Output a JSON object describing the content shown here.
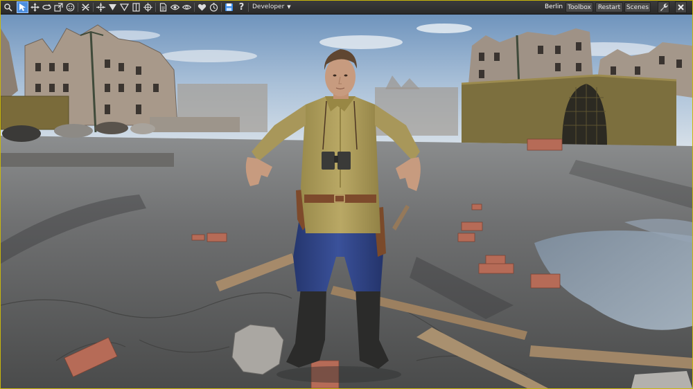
{
  "toolbar": {
    "tools": [
      {
        "name": "zoom-icon",
        "active": false
      },
      {
        "name": "select-cursor-icon",
        "active": true
      },
      {
        "name": "move-icon",
        "active": false
      },
      {
        "name": "rotate-icon",
        "active": false
      },
      {
        "name": "scale-icon",
        "active": false
      },
      {
        "name": "smiley-icon",
        "active": false
      },
      {
        "name": "cross-icon",
        "active": false
      },
      {
        "name": "snap-icon",
        "active": false
      },
      {
        "name": "filter-icon",
        "active": false
      },
      {
        "name": "funnel-icon",
        "active": false
      },
      {
        "name": "panel-icon",
        "active": false
      },
      {
        "name": "crosshair-icon",
        "active": false
      },
      {
        "name": "document-icon",
        "active": false
      },
      {
        "name": "eye-icon",
        "active": false
      },
      {
        "name": "eye-outline-icon",
        "active": false
      },
      {
        "name": "heart-icon",
        "active": false
      },
      {
        "name": "clock-icon",
        "active": false
      },
      {
        "name": "save-icon",
        "active": false
      },
      {
        "name": "help-icon",
        "active": false
      }
    ],
    "mode_select": {
      "value": "Developer"
    },
    "location_label": "Berlin",
    "toolbox_label": "Toolbox",
    "restart_label": "Restart",
    "scenes_label": "Scenes",
    "settings_icon": "wrench-icon",
    "close_icon": "close-icon"
  },
  "colors": {
    "frame_border": "#c9b70a",
    "toolbar_bg": "#333333",
    "active_tool": "#4d8fe0"
  }
}
